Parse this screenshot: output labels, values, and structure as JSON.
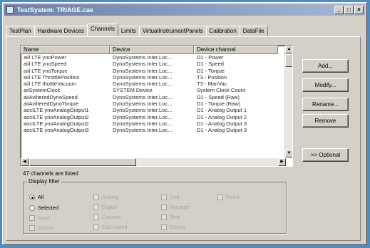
{
  "window": {
    "title": "TestSystem: TRIAGE.cae",
    "minimize_glyph": "_",
    "maximize_glyph": "□",
    "close_glyph": "×"
  },
  "tabs": [
    {
      "label": "TestPlan"
    },
    {
      "label": "Hardware Devices"
    },
    {
      "label": "Channels"
    },
    {
      "label": "Limits"
    },
    {
      "label": "VirtualInstrumentPanels"
    },
    {
      "label": "Calibration"
    },
    {
      "label": "DataFile"
    }
  ],
  "active_tab": "Channels",
  "list": {
    "columns": [
      "Name",
      "Device",
      "Device channel"
    ],
    "rows": [
      [
        "aiil LTE ynoPower",
        "DynoSystems Inter.Loc...",
        "D1 - Power"
      ],
      [
        "aiil LTE ynoSpeed",
        "DynoSystems Inter.Loc...",
        "D1 - Speed"
      ],
      [
        "aiil LTE ynoTorque",
        "DynoSystems Inter.Loc...",
        "D1 - Torque"
      ],
      [
        "aiil LTE ThrottlePosition",
        "DynoSystems Inter.Loc...",
        "T3 - Position"
      ],
      [
        "aiil LTE thottleVacuum",
        "DynoSystems Inter.Loc...",
        "T3 - ManVac"
      ],
      [
        "aiiSystemClock",
        "SYSTEM Device",
        "System Clock Count"
      ],
      [
        "aiiAvilteredDynoSpeed",
        "DynoSystems Inter.Loc...",
        "D1 - Speed (Raw)"
      ],
      [
        "aiiAvilteredDynoTorque",
        "DynoSystems Inter.Loc...",
        "D1 - Torque (Raw)"
      ],
      [
        "aocILTE ynoAnalogOutput1",
        "DynoSystems Inter.Loc...",
        "D1 - Analog Output 1"
      ],
      [
        "aocILTE ynoAnalogOutput2",
        "DynoSystems Inter.Loc...",
        "D1 - Analog Output 2"
      ],
      [
        "aocILTE ynoAnalogOutput2",
        "DynoSystems Inter.Loc...",
        "D1 - Analog Output 3"
      ],
      [
        "aocILTE ynoAnalogOutput3",
        "DynoSystems Inter.Loc...",
        "D1 - Analog Output 3"
      ]
    ]
  },
  "buttons": {
    "add": "Add...",
    "modify": "Modify...",
    "rename": "Rename...",
    "remove": "Remove",
    "optional": ">> Optional"
  },
  "status": {
    "count_text": "47 channels are listed"
  },
  "display_filter": {
    "title": "Display filter",
    "radios": [
      {
        "label": "All",
        "checked": true
      },
      {
        "label": "Selected",
        "checked": false
      }
    ],
    "checks_col0": [
      "Input",
      "Output"
    ],
    "checks_col1": [
      "Analog",
      "Digital",
      "Counter",
      "Calculated"
    ],
    "checks_col2": [
      "Unit",
      "Average",
      "Text",
      "Clamp"
    ],
    "checks_col3": [
      "Fixed"
    ]
  }
}
